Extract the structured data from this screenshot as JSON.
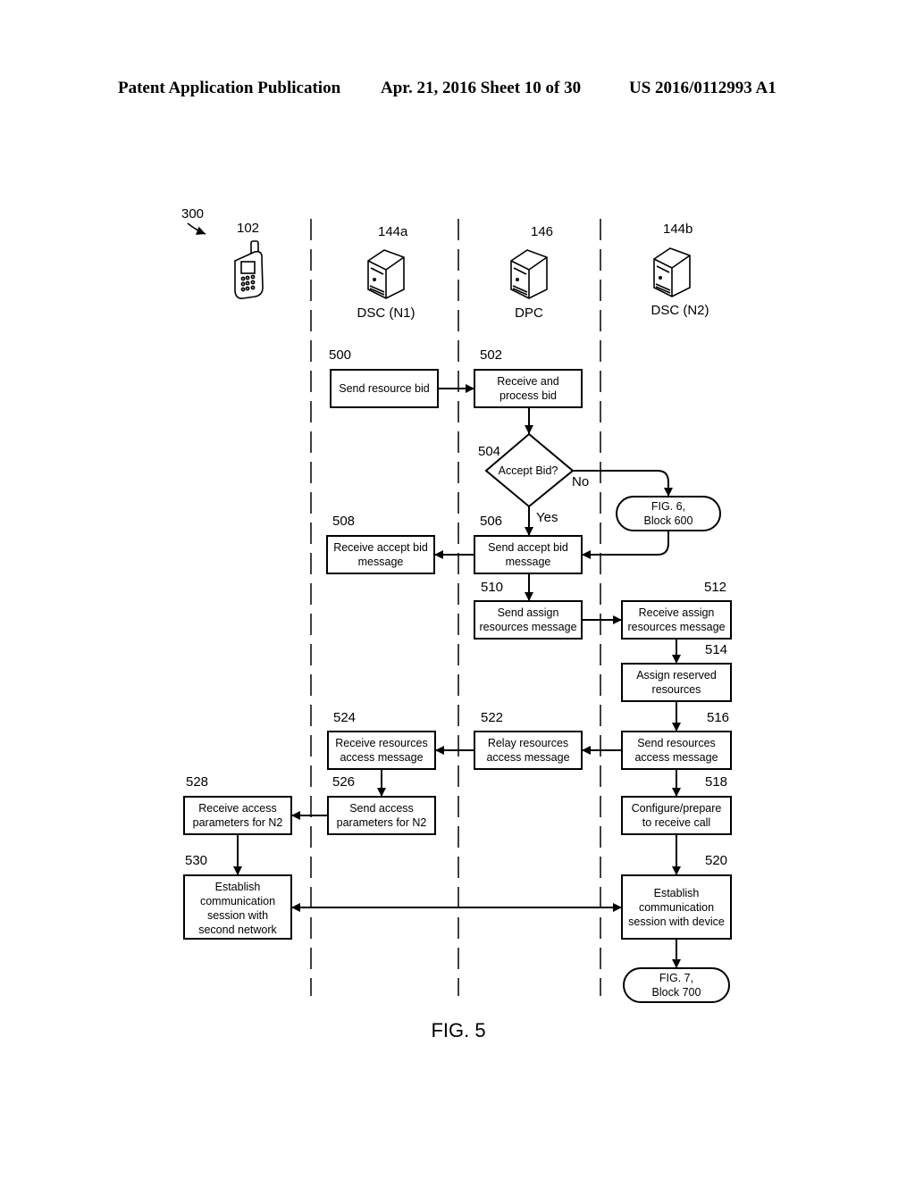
{
  "header": {
    "publication": "Patent Application Publication",
    "date_sheet": "Apr. 21, 2016  Sheet 10 of 30",
    "patent_number": "US 2016/0112993 A1"
  },
  "figure": {
    "ref": "300",
    "caption": "FIG. 5",
    "lanes": [
      {
        "ref": "102",
        "label": "",
        "icon": "mobile-phone-icon"
      },
      {
        "ref": "144a",
        "label": "DSC (N1)",
        "icon": "server-icon"
      },
      {
        "ref": "146",
        "label": "DPC",
        "icon": "server-icon"
      },
      {
        "ref": "144b",
        "label": "DSC (N2)",
        "icon": "server-icon"
      }
    ],
    "blocks": {
      "b500": {
        "ref": "500",
        "line1": "Send resource bid",
        "line2": ""
      },
      "b502": {
        "ref": "502",
        "line1": "Receive and",
        "line2": "process bid"
      },
      "b504": {
        "ref": "504",
        "line1": "Accept Bid?",
        "yes": "Yes",
        "no": "No"
      },
      "fig6": {
        "line1": "FIG. 6,",
        "line2": "Block 600"
      },
      "b506": {
        "ref": "506",
        "line1": "Send accept bid",
        "line2": "message"
      },
      "b508": {
        "ref": "508",
        "line1": "Receive accept bid",
        "line2": "message"
      },
      "b510": {
        "ref": "510",
        "line1": "Send assign",
        "line2": "resources message"
      },
      "b512": {
        "ref": "512",
        "line1": "Receive assign",
        "line2": "resources message"
      },
      "b514": {
        "ref": "514",
        "line1": "Assign reserved",
        "line2": "resources"
      },
      "b516": {
        "ref": "516",
        "line1": "Send resources",
        "line2": "access message"
      },
      "b522": {
        "ref": "522",
        "line1": "Relay resources",
        "line2": "access message"
      },
      "b524": {
        "ref": "524",
        "line1": "Receive resources",
        "line2": "access message"
      },
      "b526": {
        "ref": "526",
        "line1": "Send access",
        "line2": "parameters for N2"
      },
      "b528": {
        "ref": "528",
        "line1": "Receive access",
        "line2": "parameters for N2"
      },
      "b518": {
        "ref": "518",
        "line1": "Configure/prepare",
        "line2": "to receive call"
      },
      "b530": {
        "ref": "530",
        "line1": "Establish",
        "line2": "communication",
        "line3": "session with",
        "line4": "second network"
      },
      "b520": {
        "ref": "520",
        "line1": "Establish",
        "line2": "communication",
        "line3": "session with device"
      },
      "fig7": {
        "line1": "FIG. 7,",
        "line2": "Block 700"
      }
    }
  }
}
